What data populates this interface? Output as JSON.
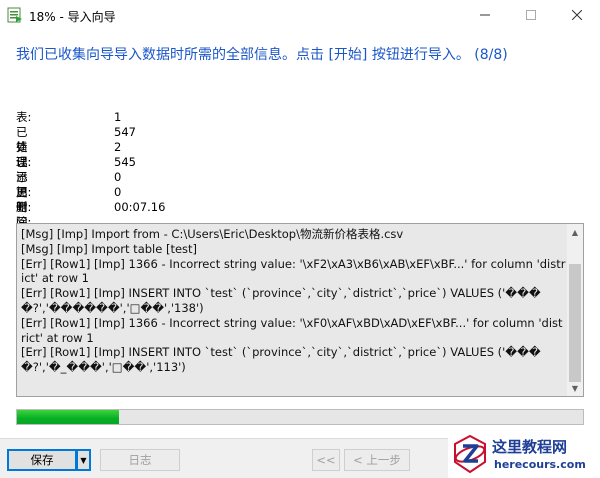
{
  "window": {
    "title": "18% - 导入向导",
    "icon": "import-wizard-icon",
    "controls": {
      "minimize": "minimize-icon",
      "maximize": "maximize-icon",
      "close": "close-icon"
    }
  },
  "heading": "我们已收集向导导入数据时所需的全部信息。点击 [开始] 按钮进行导入。 (8/8)",
  "stats": [
    {
      "label": "表:",
      "value": "1"
    },
    {
      "label": "已处理:",
      "value": "547"
    },
    {
      "label": "错误:",
      "value": "2"
    },
    {
      "label": "已添加:",
      "value": "545"
    },
    {
      "label": "已更新:",
      "value": "0"
    },
    {
      "label": "已删除:",
      "value": "0"
    },
    {
      "label": "时间:",
      "value": "00:07.16"
    }
  ],
  "log": [
    "[Msg] [Imp] Import from - C:\\Users\\Eric\\Desktop\\物流新价格表格.csv",
    "[Msg] [Imp] Import table [test]",
    "[Err] [Row1] [Imp] 1366 - Incorrect string value: '\\xF2\\xA3\\xB6\\xAB\\xEF\\xBF...' for column 'district' at row 1",
    "[Err] [Row1] [Imp] INSERT INTO `test` (`province`,`city`,`district`,`price`) VALUES ('����?','������','□��','138')",
    "[Err] [Row1] [Imp] 1366 - Incorrect string value: '\\xF0\\xAF\\xBD\\xAD\\xEF\\xBF...' for column 'district' at row 1",
    "[Err] [Row1] [Imp] INSERT INTO `test` (`province`,`city`,`district`,`price`) VALUES ('����?','�_���','□��','113')"
  ],
  "progress": {
    "percent": 18,
    "color": "#06b025"
  },
  "buttons": {
    "save": "保存",
    "log": "日志",
    "first": "<<",
    "back": "< 上一步"
  },
  "watermark": {
    "name": "这里教程网",
    "url": "herecours.com"
  },
  "colors": {
    "heading": "#1a57c8",
    "accent": "#0078d7"
  }
}
